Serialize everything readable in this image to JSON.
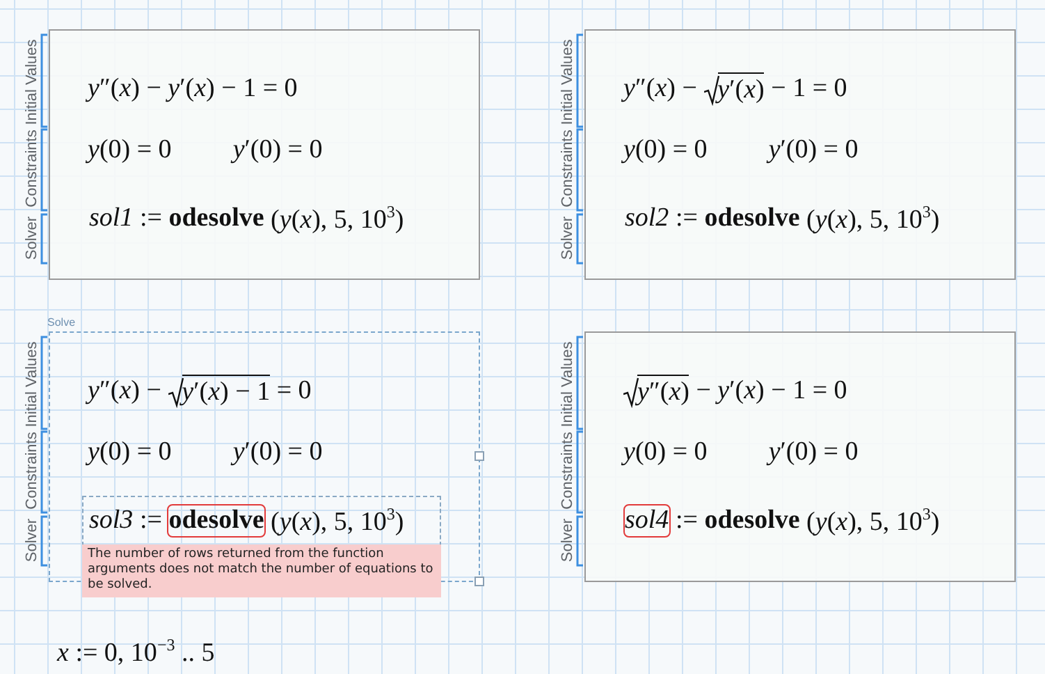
{
  "worksheet": {
    "blocks": [
      {
        "selected": false,
        "labels": [
          "Initial Values",
          "Constraints",
          "Solver"
        ],
        "equation": [
          {
            "kind": "text",
            "text": "*y*″(*x*) − *y*′(*x*) − 1 = 0"
          }
        ],
        "initial_values": [
          "*y*(0) = 0",
          "*y*′(0) = 0"
        ],
        "solver": [
          {
            "text": "*sol1*",
            "error": false
          },
          {
            "text": " := ",
            "error": false
          },
          {
            "text": "**odesolve**",
            "error": false
          },
          {
            "text": " (*y*(*x*), 5, 10$^{3}$)",
            "error": false
          }
        ]
      },
      {
        "selected": false,
        "labels": [
          "Initial Values",
          "Constraints",
          "Solver"
        ],
        "equation": [
          {
            "kind": "text",
            "text": "*y*″(*x*) − "
          },
          {
            "kind": "sqrt",
            "text": "*y*′(*x*)"
          },
          {
            "kind": "text",
            "text": " − 1 = 0"
          }
        ],
        "initial_values": [
          "*y*(0) = 0",
          "*y*′(0) = 0"
        ],
        "solver": [
          {
            "text": "*sol2*",
            "error": false
          },
          {
            "text": " := ",
            "error": false
          },
          {
            "text": "**odesolve**",
            "error": false
          },
          {
            "text": " (*y*(*x*), 5, 10$^{3}$)",
            "error": false
          }
        ]
      },
      {
        "selected": true,
        "caption": "Solve",
        "labels": [
          "Initial Values",
          "Constraints",
          "Solver"
        ],
        "equation": [
          {
            "kind": "text",
            "text": "*y*″(*x*) − "
          },
          {
            "kind": "sqrt",
            "text": "*y*′(*x*) − 1"
          },
          {
            "kind": "text",
            "text": " = 0"
          }
        ],
        "initial_values": [
          "*y*(0) = 0",
          "*y*′(0) = 0"
        ],
        "solver": [
          {
            "text": "*sol3*",
            "error": false
          },
          {
            "text": " := ",
            "error": false
          },
          {
            "text": "**odesolve**",
            "error": true
          },
          {
            "text": " (*y*(*x*), 5, 10$^{3}$)",
            "error": false
          }
        ],
        "error_message": "The number of rows returned from the function arguments does not match the number of equations to be solved."
      },
      {
        "selected": false,
        "labels": [
          "Initial Values",
          "Constraints",
          "Solver"
        ],
        "equation": [
          {
            "kind": "sqrt",
            "text": "*y*″(*x*)"
          },
          {
            "kind": "text",
            "text": " − *y*′(*x*) − 1 = 0"
          }
        ],
        "initial_values": [
          "*y*(0) = 0",
          "*y*′(0) = 0"
        ],
        "solver": [
          {
            "text": "*sol4*",
            "error": true
          },
          {
            "text": " := ",
            "error": false
          },
          {
            "text": "**odesolve**",
            "error": false
          },
          {
            "text": " (*y*(*x*), 5, 10$^{3}$)",
            "error": false
          }
        ]
      }
    ],
    "range_definition": "*x* := 0, 10$^{−3}$ .. 5"
  }
}
